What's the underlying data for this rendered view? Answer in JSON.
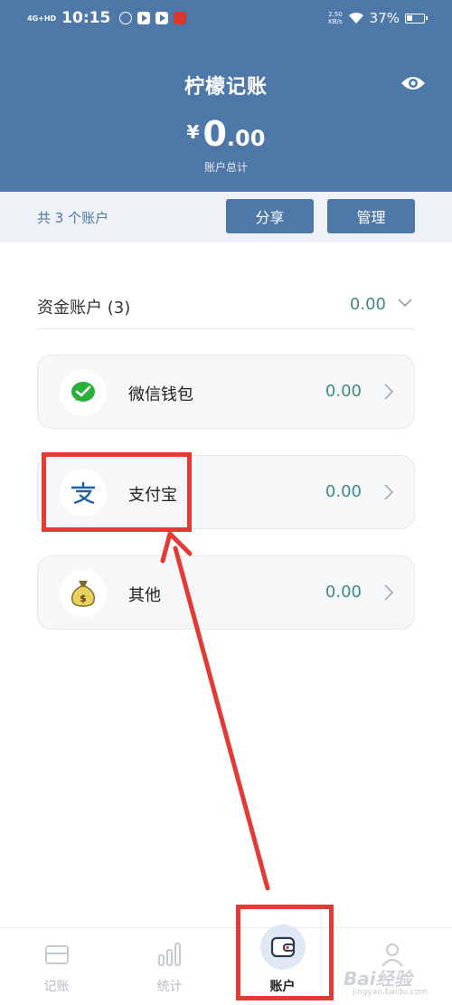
{
  "status_bar": {
    "network": "4G+HD",
    "time": "10:15",
    "net_speed_value": "2.50",
    "net_speed_unit": "KB/s",
    "battery": "37%"
  },
  "header": {
    "title": "柠檬记账",
    "currency_symbol": "¥",
    "total_int": "0",
    "total_dec": ".00",
    "total_label": "账户总计"
  },
  "toolbar": {
    "account_count": "共 3 个账户",
    "share_label": "分享",
    "manage_label": "管理"
  },
  "group": {
    "title": "资金账户 (3)",
    "total": "0.00"
  },
  "accounts": [
    {
      "name": "微信钱包",
      "balance": "0.00",
      "icon": "wechat-icon"
    },
    {
      "name": "支付宝",
      "balance": "0.00",
      "icon": "alipay-icon"
    },
    {
      "name": "其他",
      "balance": "0.00",
      "icon": "money-bag-icon"
    }
  ],
  "nav": [
    {
      "label": "记账",
      "icon": "card-icon"
    },
    {
      "label": "统计",
      "icon": "bar-chart-icon"
    },
    {
      "label": "账户",
      "icon": "wallet-icon",
      "active": true
    },
    {
      "label": "",
      "icon": "profile-icon"
    }
  ],
  "watermark": {
    "text": "Bai经验",
    "sub": "jingyan.baidu.com"
  },
  "colors": {
    "header": "#4e78a8",
    "accent_value": "#3e8b85",
    "annotation": "#e33b34"
  }
}
